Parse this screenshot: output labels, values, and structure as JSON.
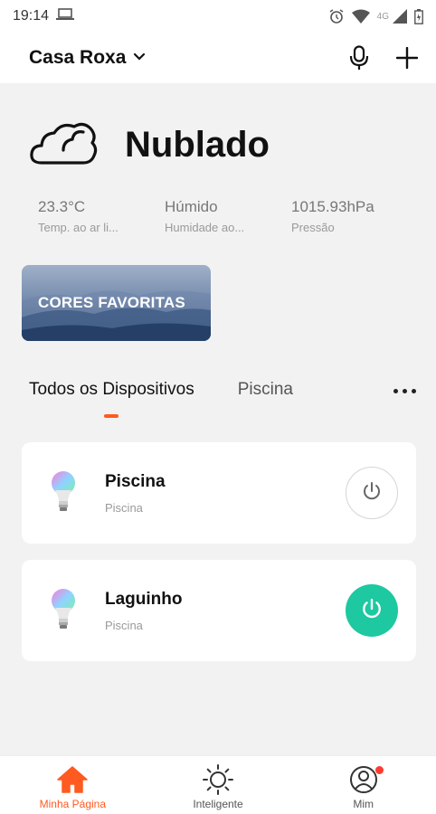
{
  "status_bar": {
    "time": "19:14",
    "network": "4G",
    "icons": [
      "laptop-icon",
      "alarm-icon",
      "wifi-icon",
      "signal-icon",
      "battery-icon"
    ]
  },
  "header": {
    "home_name": "Casa Roxa",
    "icons": [
      "chevron-down-icon",
      "microphone-icon",
      "plus-icon"
    ]
  },
  "weather": {
    "condition": "Nublado",
    "icon": "cloud-icon",
    "stats": [
      {
        "value": "23.3°C",
        "label": "Temp. ao ar li..."
      },
      {
        "value": "Húmido",
        "label": "Humidade ao..."
      },
      {
        "value": "1015.93hPa",
        "label": "Pressão"
      }
    ]
  },
  "banner": {
    "label": "CORES FAVORITAS"
  },
  "tabs": {
    "items": [
      {
        "label": "Todos os Dispositivos",
        "active": true
      },
      {
        "label": "Piscina",
        "active": false
      }
    ],
    "more_icon": "more-dots-icon"
  },
  "devices": [
    {
      "name": "Piscina",
      "room": "Piscina",
      "power": "off",
      "icon": "rgb-bulb-icon"
    },
    {
      "name": "Laguinho",
      "room": "Piscina",
      "power": "on",
      "icon": "rgb-bulb-icon"
    }
  ],
  "bottom_nav": {
    "items": [
      {
        "label": "Minha Página",
        "icon": "home-icon",
        "active": true
      },
      {
        "label": "Inteligente",
        "icon": "sun-icon",
        "active": false
      },
      {
        "label": "Mim",
        "icon": "user-icon",
        "active": false,
        "badge": true
      }
    ]
  },
  "colors": {
    "accent": "#ff5a1f",
    "power_on": "#1ec8a0",
    "notification": "#ff3b30"
  }
}
